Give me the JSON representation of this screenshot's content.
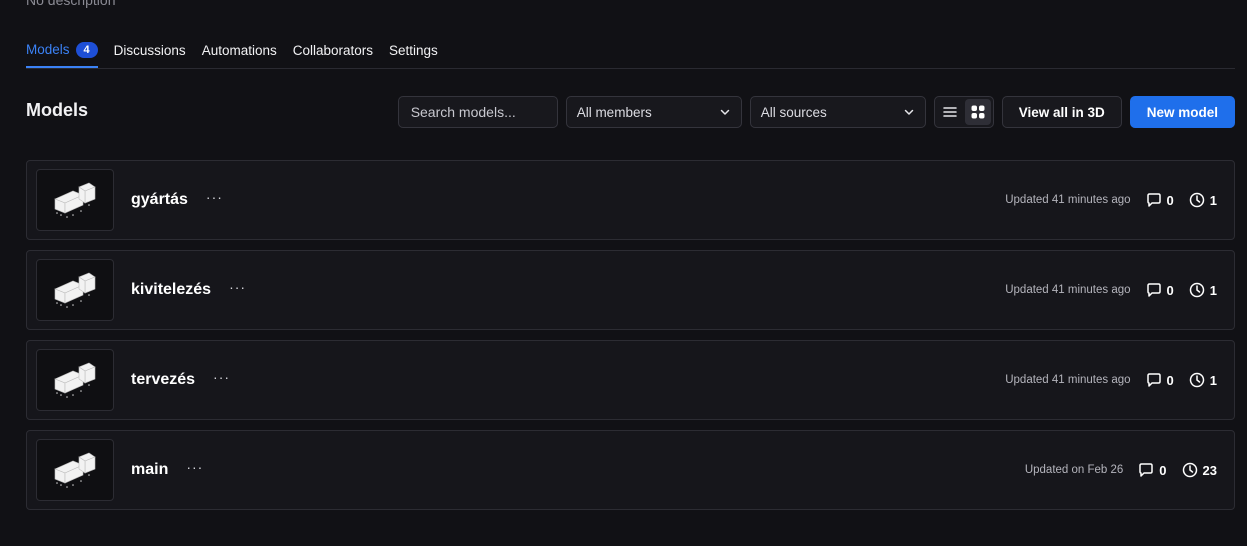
{
  "header": {
    "description": "No description"
  },
  "tabs": [
    {
      "label": "Models",
      "count": "4",
      "active": true
    },
    {
      "label": "Discussions"
    },
    {
      "label": "Automations"
    },
    {
      "label": "Collaborators"
    },
    {
      "label": "Settings"
    }
  ],
  "section": {
    "title": "Models"
  },
  "toolbar": {
    "search_placeholder": "Search models...",
    "members_value": "All members",
    "sources_value": "All sources",
    "view_all_label": "View all in 3D",
    "new_model_label": "New model"
  },
  "models": [
    {
      "name": "gyártás",
      "updated": "Updated 41 minutes ago",
      "comments": "0",
      "versions": "1"
    },
    {
      "name": "kivitelezés",
      "updated": "Updated 41 minutes ago",
      "comments": "0",
      "versions": "1"
    },
    {
      "name": "tervezés",
      "updated": "Updated 41 minutes ago",
      "comments": "0",
      "versions": "1"
    },
    {
      "name": "main",
      "updated": "Updated on Feb 26",
      "comments": "0",
      "versions": "23"
    }
  ],
  "more_label": "···",
  "colors": {
    "accent": "#3b82f6",
    "primary_button": "#1f6feb",
    "background": "#111115"
  },
  "icons": [
    "chevron-down-icon",
    "list-view-icon",
    "grid-view-icon",
    "comment-icon",
    "history-icon",
    "model-thumbnail"
  ]
}
